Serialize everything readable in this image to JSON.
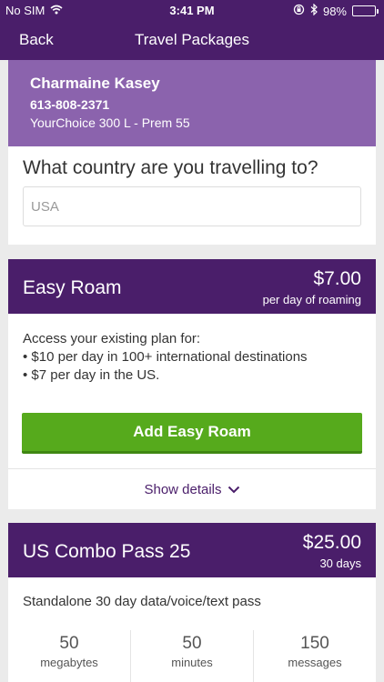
{
  "status_bar": {
    "carrier": "No SIM",
    "time": "3:41 PM",
    "battery": "98%",
    "battery_level": 0.98
  },
  "nav": {
    "back_label": "Back",
    "title": "Travel Packages"
  },
  "customer": {
    "name": "Charmaine Kasey",
    "phone": "613-808-2371",
    "plan": "YourChoice 300 L - Prem 55"
  },
  "country": {
    "question": "What country are you travelling to?",
    "value": "USA"
  },
  "packages": [
    {
      "name": "Easy Roam",
      "price": "$7.00",
      "unit": "per day of roaming",
      "intro": "Access your existing plan for:",
      "bullets": [
        "$10 per day in 100+ international destinations",
        "$7 per day in the US."
      ],
      "add_label": "Add Easy Roam",
      "details_label": "Show details"
    },
    {
      "name": "US Combo Pass 25",
      "price": "$25.00",
      "unit": "30 days",
      "description": "Standalone 30 day data/voice/text pass",
      "stats": [
        {
          "value": "50",
          "label": "megabytes"
        },
        {
          "value": "50",
          "label": "minutes"
        },
        {
          "value": "150",
          "label": "messages"
        }
      ]
    }
  ],
  "colors": {
    "brand_purple": "#4a1e6a",
    "light_purple": "#8b63ad",
    "green": "#56aa1c"
  }
}
